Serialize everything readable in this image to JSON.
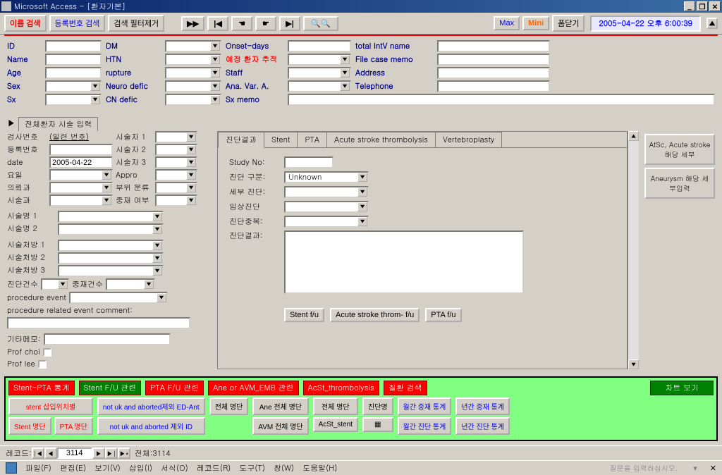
{
  "titlebar": {
    "app_title": "Microsoft Access - [환자기본]"
  },
  "toolbar": {
    "name_search": "이름 검색",
    "regno_search": "등록번호 검색",
    "filter_remove": "검색 필터제거",
    "max": "Max",
    "mini": "Mini",
    "zoom": "폼닫기",
    "datetime": "2005-04-22 오후 6:00:39"
  },
  "patient": {
    "labels": {
      "id": "ID",
      "name": "Name",
      "age": "Age",
      "sex": "Sex",
      "sx": "Sx",
      "dm": "DM",
      "htn": "HTN",
      "rupture": "rupture",
      "neuro": "Neuro defic",
      "cn": "CN defic",
      "onset": "Onset-days",
      "schedule": "예정 환자 추적",
      "staff": "Staff",
      "ana": "Ana. Var. A.",
      "sxmemo": "Sx memo",
      "intv": "total IntV name",
      "filecase": "File case memo",
      "address": "Address",
      "tel": "Telephone"
    }
  },
  "section_tab": "전체환자 시술 입력",
  "left": {
    "examno": "검사번호",
    "serial": "(일련 번호)",
    "op1": "시술자 1",
    "regno": "등록번호",
    "op2": "시술자 2",
    "date_lbl": "date",
    "date_val": "2005-04-22",
    "op3": "시술자 3",
    "day": "요일",
    "appro": "Appro",
    "req": "의뢰과",
    "region": "부위 분류",
    "dept": "시술과",
    "interv": "중재 여부",
    "p1": "시술명 1",
    "p2": "시술명 2",
    "rx1": "시술처방 1",
    "rx2": "시술처방 2",
    "rx3": "시술처방 3",
    "diag_cnt": "진단건수",
    "interv_cnt": "중재건수",
    "pevent": "procedure event",
    "pcomment": "procedure related event comment:",
    "etc": "기타메모:",
    "profc": "Prof choi",
    "profl": "Prof lee"
  },
  "tabs": [
    "진단결과",
    "Stent",
    "PTA",
    "Acute stroke thrombolysis",
    "Vertebroplasty"
  ],
  "center": {
    "study_no": "Study No:",
    "diag_class": "진단 구분:",
    "diag_class_val": "Unknown",
    "detail_diag": "세부 진단:",
    "clinical": "임상진단",
    "dup": "진단중복:",
    "result": "진단결과:",
    "stent_fu": "Stent f/u",
    "acute_fu": "Acute stroke throm- f/u",
    "pta_fu": "PTA f/u"
  },
  "right_buttons": {
    "atsc": "AtSc, Acute stroke 해당 세부",
    "aneu": "Aneurysm 해당 세부입력"
  },
  "bottom": {
    "headers": {
      "stent_pta": "Stent-PTA 통계",
      "stent_fu": "Stent F/U 관련",
      "pta_fu": "PTA  F/U 관련",
      "ane_avm": "Ane or AVM_EMB 관련",
      "acst": "AcSt_thrombolysis",
      "disease": "질환 검색",
      "chart": "차트 보기"
    },
    "buttons": {
      "stent_pos": "stent 삽입위치별",
      "stent_list": "Stent 명단",
      "pta_list": "PTA 명단",
      "not_uk1": "not uk and aborted제외 ED-Ant",
      "not_uk2": "not uk and aborted 제외 ID",
      "all_list": "전체 명단",
      "ane_all": "Ane 전체 명단",
      "avm_all": "AVM 전체 명단",
      "acst_all": "전체 명단",
      "acst_stent": "AcSt_stent",
      "diag_name": "진단명",
      "monthly_interv": "월간 중재 통계",
      "yearly_interv": "년간 중재 통계",
      "monthly_diag": "월간 진단 통계",
      "yearly_diag": "년간 진단 통계"
    }
  },
  "record": {
    "label": "레코드:",
    "current": "3114",
    "total_label": "전체:",
    "total": "3114"
  },
  "menu": {
    "file": "파일(F)",
    "edit": "편집(E)",
    "view": "보기(V)",
    "insert": "삽입(I)",
    "format": "서식(O)",
    "records": "레코드(R)",
    "tools": "도구(T)",
    "window": "창(W)",
    "help": "도움말(H)",
    "status": "질문을 입력하십시오."
  }
}
